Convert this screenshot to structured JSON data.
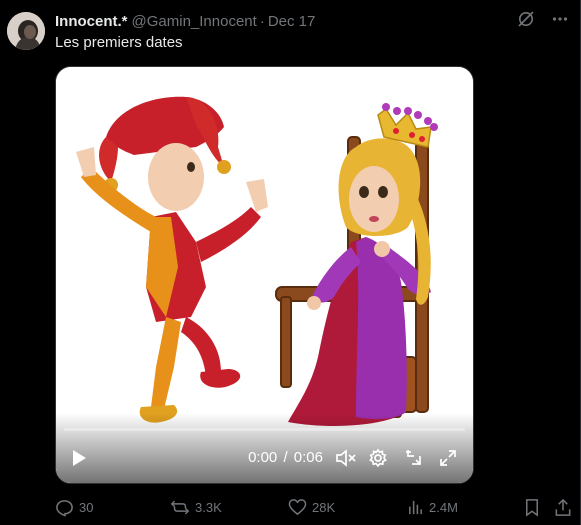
{
  "post": {
    "display_name": "Innocent.",
    "verified_mark": "*",
    "handle": "@Gamin_Innocent",
    "separator": "·",
    "date": "Dec 17",
    "text": "Les premiers dates",
    "top_icons": [
      "grok-icon",
      "more-icon"
    ]
  },
  "video": {
    "current_time": "0:00",
    "time_separator": "/",
    "duration": "0:06",
    "progress_fraction": 0.0,
    "controls": [
      "play-icon",
      "mute-icon",
      "settings-icon",
      "exit-fullscreen-icon",
      "fullscreen-icon"
    ]
  },
  "actions": {
    "replies": "30",
    "reposts": "3.3K",
    "likes": "28K",
    "views": "2.4M"
  },
  "colors": {
    "background": "#000000",
    "text": "#e7e9ea",
    "muted": "#71767b",
    "border": "#2f3336"
  }
}
